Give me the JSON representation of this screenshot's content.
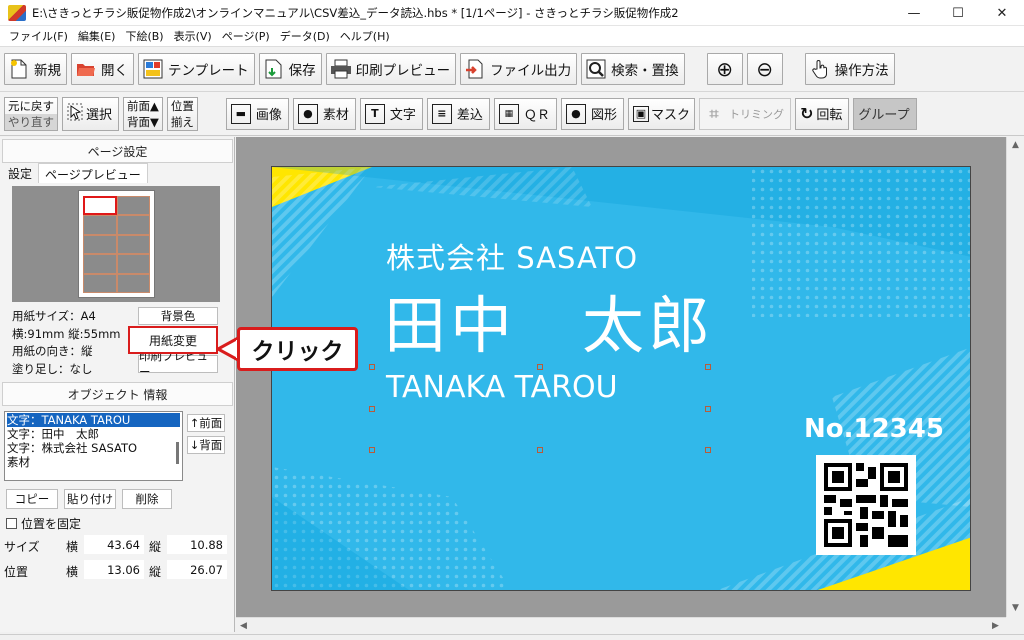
{
  "window": {
    "title": "E:\\さきっとチラシ販促物作成2\\オンラインマニュアル\\CSV差込_データ読込.hbs *  [1/1ページ] - さきっとチラシ販促物作成2",
    "minimize": "—",
    "maximize": "☐",
    "close": "✕"
  },
  "menu": [
    "ファイル(F)",
    "編集(E)",
    "下絵(B)",
    "表示(V)",
    "ページ(P)",
    "データ(D)",
    "ヘルプ(H)"
  ],
  "toolbar1": {
    "new": "新規",
    "open": "開く",
    "template": "テンプレート",
    "save": "保存",
    "print_preview": "印刷プレビュー",
    "file_output": "ファイル出力",
    "search_replace": "検索・置換",
    "zoom_in": "⊕",
    "zoom_out": "⊖",
    "howto": "操作方法"
  },
  "toolbar2": {
    "undo": "元に戻す",
    "redo": "やり直す",
    "select": "選択",
    "front": "前面▲",
    "back": "背面▼",
    "pos1": "位置",
    "pos2": "揃え",
    "image": "画像",
    "material": "素材",
    "text": "文字",
    "merge": "差込",
    "qr": "ＱＲ",
    "shape": "図形",
    "mask": "マスク",
    "trim": "トリミング",
    "rotate": "回転",
    "group": "グループ"
  },
  "page_settings": {
    "header": "ページ設定",
    "tab_settings": "設定",
    "tab_preview": "ページプレビュー",
    "paper_size": "用紙サイズ：A4",
    "dimensions": "横:91mm 縦:55mm",
    "orientation": "用紙の向き：縦",
    "bleed": "塗り足し：なし",
    "bg_color_button": "背景色",
    "change_paper_button": "用紙変更",
    "print_preview_button": "印刷プレビュー"
  },
  "object_info": {
    "header": "オブジェクト 情報",
    "items": [
      "文字：TANAKA TAROU",
      "文字：田中　太郎",
      "文字：株式会社 SASATO",
      "素材"
    ],
    "front_button": "↑前面",
    "back_button": "↓背面",
    "copy_button": "コピー",
    "paste_button": "貼り付け",
    "delete_button": "削除",
    "lock_position": "位置を固定",
    "size_label": "サイズ",
    "pos_label": "位置",
    "w_label": "横",
    "h_label": "縦",
    "size_w": "43.64",
    "size_h": "10.88",
    "pos_x": "13.06",
    "pos_y": "26.07"
  },
  "card": {
    "company": "株式会社 SASATO",
    "name": "田中　太郎",
    "roman": "TANAKA TAROU",
    "number": "No.12345",
    "bg_color": "#31b8ea",
    "accent_color": "#ffe600"
  },
  "callout": {
    "text": "クリック",
    "color": "#d91c1c"
  }
}
